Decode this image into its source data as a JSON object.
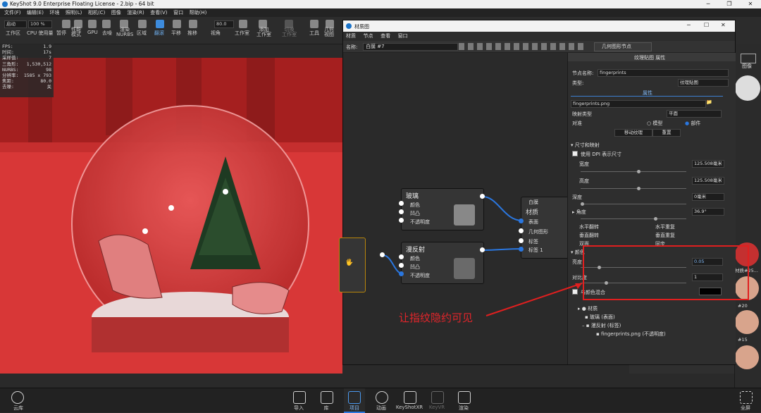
{
  "app": {
    "title": "KeyShot 9.0 Enterprise Floating License  - 2.bip  - 64 bit"
  },
  "menu": [
    "文件(F)",
    "编辑(E)",
    "环境",
    "照明(L)",
    "相机(C)",
    "图像",
    "渲染(R)",
    "查看(V)",
    "窗口",
    "帮助(H)"
  ],
  "toolbar": {
    "startup_label": "启动",
    "cpu_pct": "100 %",
    "fov_value": "80.0",
    "items": [
      {
        "label": "工作区"
      },
      {
        "label": "CPU 使用量"
      },
      {
        "label": "暂停"
      },
      {
        "label": "性能\n模式"
      },
      {
        "label": "GPU"
      },
      {
        "label": "去噪"
      },
      {
        "label": "渲染\nNURBS"
      },
      {
        "label": "区域"
      },
      {
        "label": "翻滚"
      },
      {
        "label": "平移"
      },
      {
        "label": "推移"
      },
      {
        "label": "视角"
      },
      {
        "label": "工作室"
      },
      {
        "label": "添加\n工作室"
      },
      {
        "label": "切换\n工作室"
      },
      {
        "label": "工具"
      },
      {
        "label": "几何\n视图"
      }
    ]
  },
  "stats": [
    {
      "k": "FPS:",
      "v": "1.9"
    },
    {
      "k": "时间:",
      "v": "17s"
    },
    {
      "k": "采样值:",
      "v": "7"
    },
    {
      "k": "三角形:",
      "v": "1,530,512"
    },
    {
      "k": "NURBS:",
      "v": "98"
    },
    {
      "k": "分辨率:",
      "v": "1585 x 793"
    },
    {
      "k": "焦距:",
      "v": "80.0"
    },
    {
      "k": "去噪:",
      "v": "关"
    }
  ],
  "material_graph": {
    "window_title": "材质图",
    "menu": [
      "材质",
      "节点",
      "查看",
      "窗口"
    ],
    "name_label": "名称:",
    "name_value": "白膜 #7",
    "geometry_node_button": "几何图形节点",
    "nodes": {
      "glass": {
        "title": "玻璃",
        "inputs": [
          "颜色",
          "凹凸",
          "不透明度"
        ]
      },
      "diffuse": {
        "title": "漫反射",
        "inputs": [
          "颜色",
          "凹凸",
          "不透明度"
        ]
      },
      "material": {
        "header": "白膜 ",
        "title": "材质",
        "inputs": [
          "表面",
          "几何图形",
          "标签",
          "标签 1"
        ]
      }
    }
  },
  "properties": {
    "panel_title": "纹理贴图 属性",
    "node_name_label": "节点名称:",
    "node_name_value": "fingerprints",
    "type_label": "类型:",
    "type_value": "纹理贴图",
    "tab_label": "属性",
    "file_value": "fingerprints.png",
    "mapping_label": "映射类型",
    "mapping_value": "平面",
    "align_label": "对准",
    "align_model": "模型",
    "align_part": "部件",
    "move_texture": "移动纹理",
    "reset": "重置",
    "size_section": "尺寸和映射",
    "dpi_label": "使用 DPI 表示尺寸",
    "width_label": "宽度",
    "width_value": "125.508毫米",
    "height_label": "高度",
    "height_value": "125.508毫米",
    "depth_label": "深度",
    "depth_value": "0毫米",
    "angle_label": "角度",
    "angle_value": "36.9°",
    "flip_h": "水平翻转",
    "repeat_h": "水平重复",
    "flip_v": "垂直翻转",
    "repeat_v": "垂直重复",
    "two_sided": "双面",
    "sync": "同步",
    "color_section": "颜色",
    "brightness_label": "亮度",
    "brightness_value": "0.05",
    "contrast_label": "对比度",
    "contrast_value": "1",
    "blend_label": "与颜色混合",
    "tree": [
      "材质",
      "玻璃 (表面)",
      "漫反射 (标签)",
      "fingerprints.png (不透明度)"
    ]
  },
  "right_panel": {
    "image_label": "图像",
    "thumb_labels": [
      "#20",
      "#15",
      "材质#25..."
    ],
    "fullscreen_label": "全屏"
  },
  "bottom_bar": {
    "cloud": "云库",
    "items": [
      "导入",
      "库",
      "项目",
      "动画",
      "KeyShotXR",
      "KeyVR",
      "渲染"
    ]
  },
  "annotation": {
    "text": "让指纹隐约可见",
    "color": "#e2252b"
  },
  "colors": {
    "accent": "#2a77e0",
    "annotation_box": "#e01f1f"
  }
}
